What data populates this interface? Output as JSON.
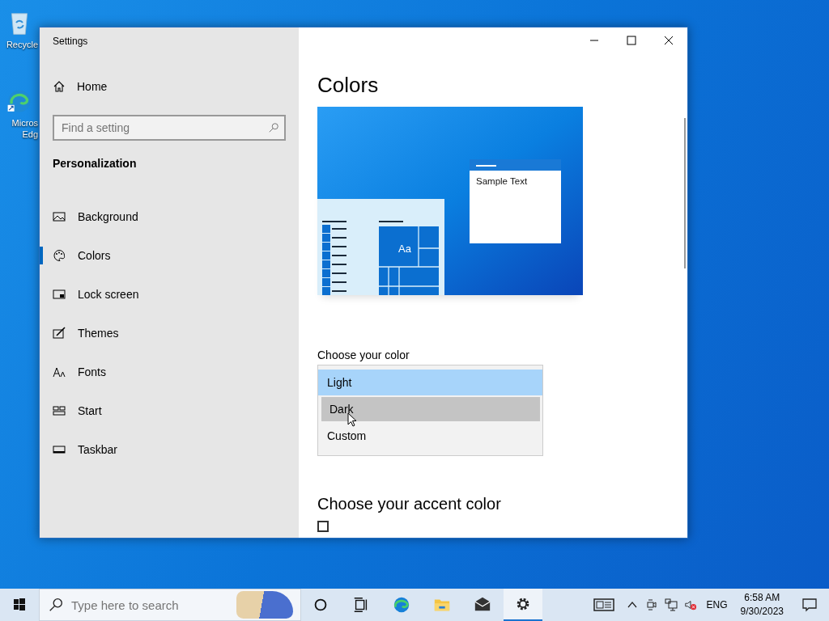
{
  "desktop": {
    "icons": [
      {
        "kind": "recycle",
        "label": "Recycle"
      },
      {
        "kind": "edge",
        "label": "Micros Edg"
      }
    ]
  },
  "window": {
    "title": "Settings"
  },
  "sidebar": {
    "home": "Home",
    "search": {
      "placeholder": "Find a setting"
    },
    "section": "Personalization",
    "items": [
      {
        "kind": "picture",
        "label": "Background",
        "selected": false
      },
      {
        "kind": "palette",
        "label": "Colors",
        "selected": true
      },
      {
        "kind": "lock",
        "label": "Lock screen",
        "selected": false
      },
      {
        "kind": "brush",
        "label": "Themes",
        "selected": false
      },
      {
        "kind": "fonts",
        "label": "Fonts",
        "selected": false
      },
      {
        "kind": "start",
        "label": "Start",
        "selected": false
      },
      {
        "kind": "taskbar",
        "label": "Taskbar",
        "selected": false
      }
    ]
  },
  "content": {
    "heading": "Colors",
    "preview": {
      "tile_label": "Aa",
      "sample_text": "Sample Text"
    },
    "color_label": "Choose your color",
    "dropdown": {
      "options": [
        {
          "label": "Light",
          "selected": true,
          "hovered": false
        },
        {
          "label": "Dark",
          "selected": false,
          "hovered": true
        },
        {
          "label": "Custom",
          "selected": false,
          "hovered": false
        }
      ]
    },
    "accent_heading": "Choose your accent color",
    "accent_checkbox": {
      "checked": false
    }
  },
  "taskbar": {
    "search": {
      "placeholder": "Type here to search"
    },
    "apps": [
      {
        "kind": "cortana",
        "active": false
      },
      {
        "kind": "taskview",
        "active": false
      },
      {
        "kind": "edge",
        "active": false
      },
      {
        "kind": "explorer",
        "active": false
      },
      {
        "kind": "mail",
        "active": false
      },
      {
        "kind": "settings",
        "active": true
      }
    ],
    "language": "ENG",
    "time": "6:58 AM",
    "date": "9/30/2023"
  }
}
